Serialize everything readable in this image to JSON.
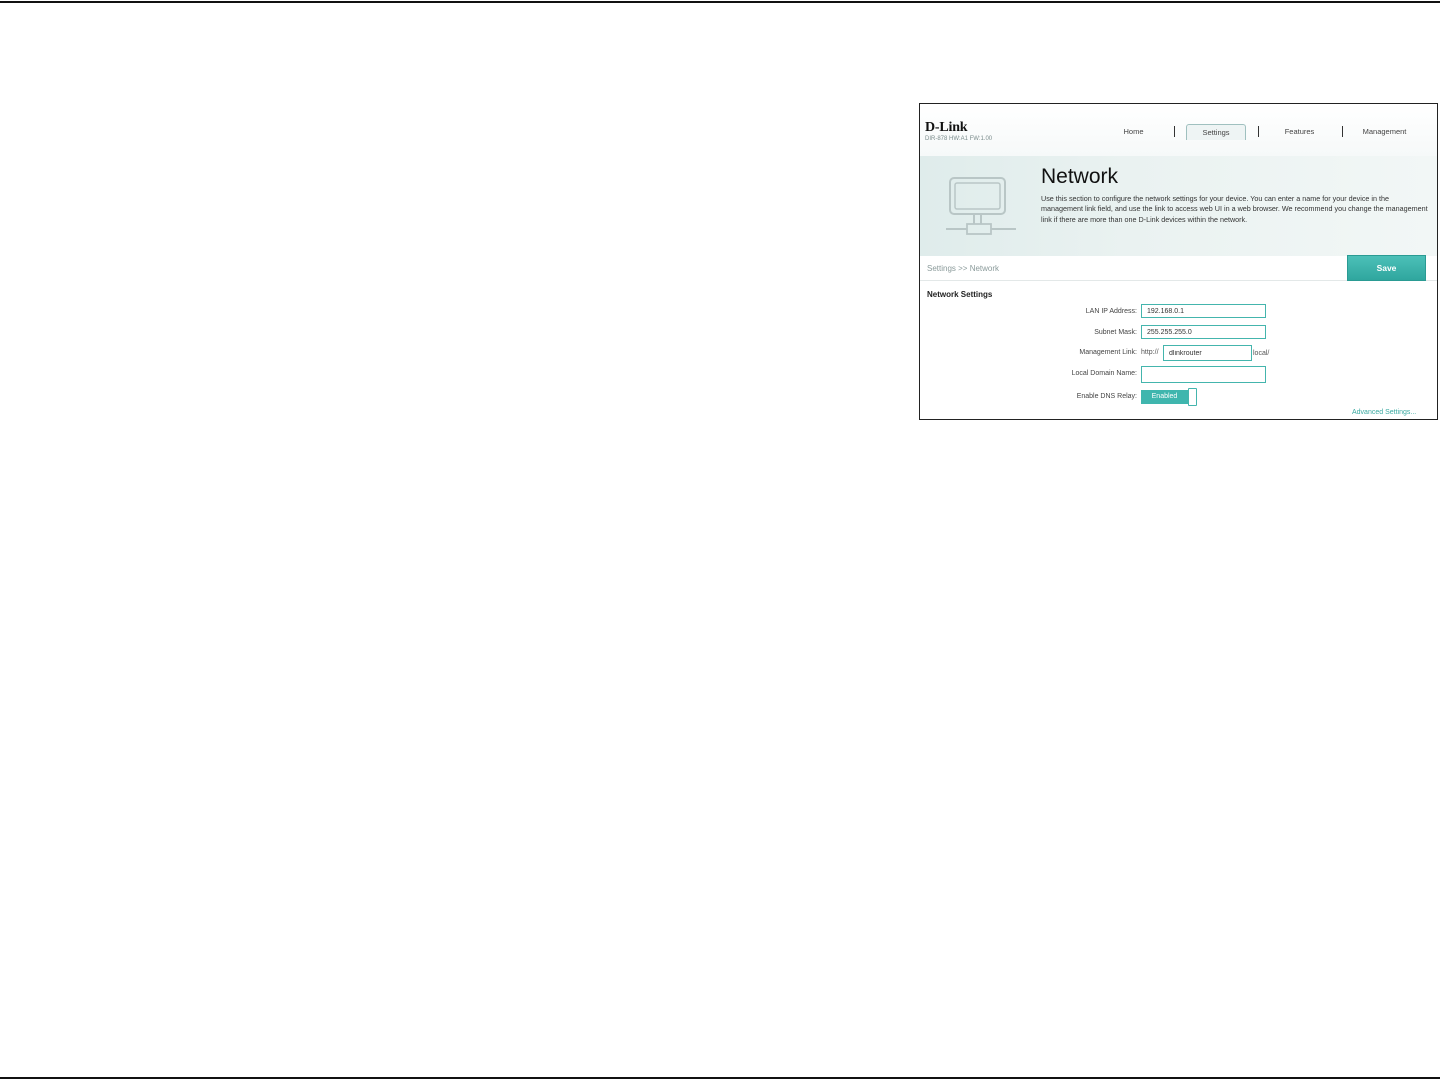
{
  "brand": {
    "logo": "D-Link",
    "model_info": "DIR-878 HW:A1 FW:1.00"
  },
  "nav": {
    "home": "Home",
    "settings": "Settings",
    "features": "Features",
    "management": "Management"
  },
  "hero": {
    "icon": "monitor-network-icon",
    "title": "Network",
    "description": "Use this section to configure the network settings for your device. You can enter a name for your device in the management link field, and use the link to access web UI in a web browser. We recommend you change the management link if there are more than one D-Link devices within the network."
  },
  "breadcrumb": "Settings >> Network",
  "save_label": "Save",
  "network_settings": {
    "title": "Network Settings",
    "lan_ip": {
      "label": "LAN IP Address:",
      "value": "192.168.0.1"
    },
    "subnet_mask": {
      "label": "Subnet Mask:",
      "value": "255.255.255.0"
    },
    "management_link": {
      "label": "Management Link:",
      "prefix": "http://",
      "value": "dlinkrouter",
      "suffix": "local/"
    },
    "local_domain": {
      "label": "Local Domain Name:",
      "value": ""
    },
    "dns_relay": {
      "label": "Enable DNS Relay:",
      "state": "Enabled"
    }
  },
  "advanced_link": "Advanced Settings...",
  "colors": {
    "accent": "#3fb6ae",
    "hero_bg": "#e6f0ef"
  }
}
